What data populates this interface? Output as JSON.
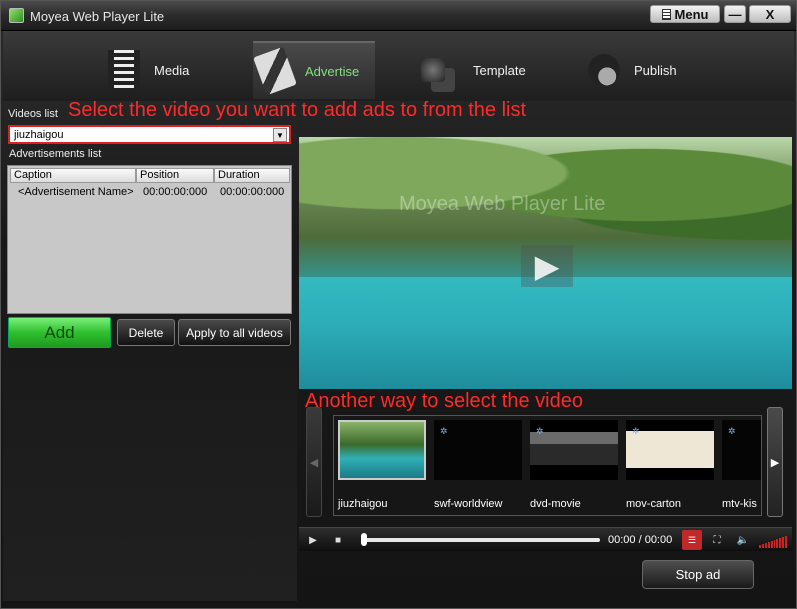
{
  "window": {
    "title": "Moyea Web Player Lite",
    "menu_label": "Menu",
    "minimize_label": "—",
    "close_label": "X"
  },
  "tabs": [
    {
      "label": "Media",
      "icon": "film-icon"
    },
    {
      "label": "Advertise",
      "icon": "clapper-icon",
      "active": true
    },
    {
      "label": "Template",
      "icon": "template-icon"
    },
    {
      "label": "Publish",
      "icon": "publish-icon"
    }
  ],
  "annotations": {
    "select_hint": "Select the video you want to add ads to from the list",
    "another_way_hint": "Another way to select the video"
  },
  "videos": {
    "label": "Videos list",
    "selected": "jiuzhaigou"
  },
  "ads": {
    "label": "Advertisements  list",
    "columns": [
      "Caption",
      "Position",
      "Duration"
    ],
    "rows": [
      {
        "caption": "<Advertisement Name>",
        "position": "00:00:00:000",
        "duration": "00:00:00:000"
      }
    ]
  },
  "buttons": {
    "add": "Add",
    "delete": "Delete",
    "apply_all": "Apply to all videos",
    "stop_ad": "Stop ad"
  },
  "player": {
    "watermark": "Moyea Web Player Lite",
    "time": "00:00 / 00:00"
  },
  "thumbnails": [
    {
      "caption": "jiuzhaigou"
    },
    {
      "caption": "swf-worldview"
    },
    {
      "caption": "dvd-movie"
    },
    {
      "caption": "mov-carton"
    },
    {
      "caption": "mtv-kis"
    }
  ],
  "colors": {
    "accent_green": "#2fbf2f",
    "hint_red": "#ff2a2a",
    "active_tab_text": "#7fe37f"
  }
}
